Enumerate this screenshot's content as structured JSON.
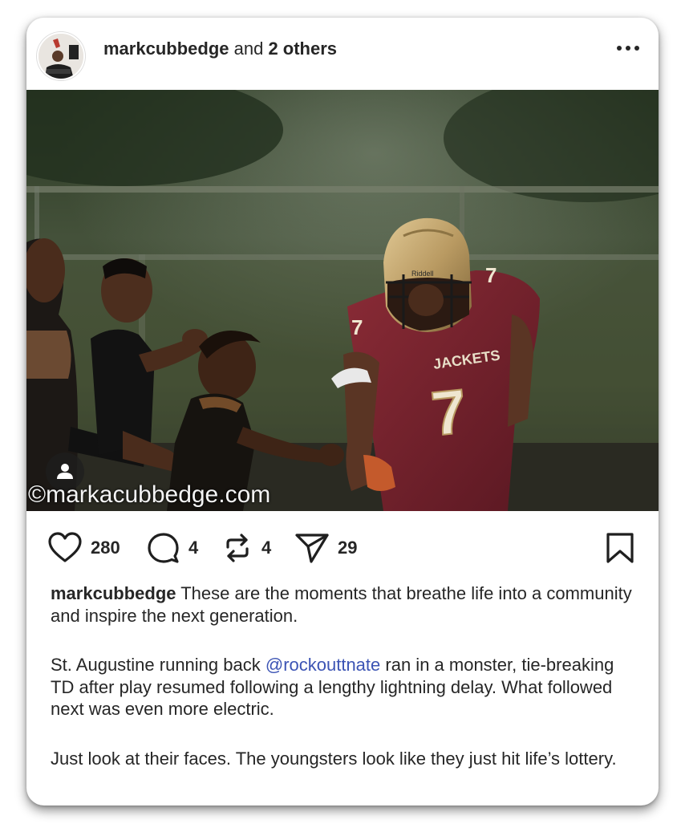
{
  "post": {
    "author_username": "markcubbedge",
    "author_connector": " and ",
    "coauthors": "2 others",
    "watermark": "©markacubbedge.com",
    "likes": "280",
    "comments": "4",
    "reposts": "4",
    "shares": "29",
    "caption": {
      "username": "markcubbedge",
      "p1": " These are the moments that breathe life into a community and inspire the next generation.",
      "p2_before": "St. Augustine running back ",
      "p2_mention": "@rockouttnate",
      "p2_after": " ran in a monster, tie-breaking TD after play resumed following a lengthy lightning delay. What followed next was even more electric.",
      "p3": "Just look at their faces. The youngsters look like they just hit life’s lottery."
    }
  },
  "photo_text": {
    "jersey_team": "JACKETS",
    "jersey_number": "7",
    "helmet_brand": "Riddell"
  },
  "icons": {
    "like": "heart-icon",
    "comment": "speech-bubble-icon",
    "repost": "repost-arrows-icon",
    "share": "paper-plane-icon",
    "save": "bookmark-icon",
    "more": "more-dots-icon",
    "tag": "person-tag-icon"
  },
  "colors": {
    "text": "#262626",
    "mention": "#3c54b4",
    "jersey_maroon": "#6e1f2a",
    "helmet_gold": "#b99a62"
  }
}
